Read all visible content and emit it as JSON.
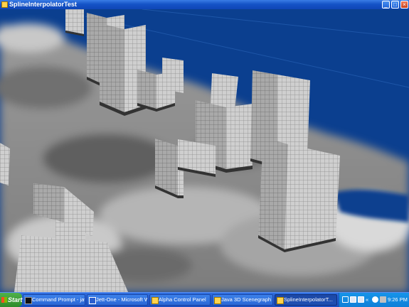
{
  "window": {
    "title": "SplineInterpolatorTest",
    "controls": {
      "minimize": "_",
      "maximize": "□",
      "close": "×"
    }
  },
  "scene": {
    "sky_color": "#0b3f8f",
    "ground_color": "#8d8d8d",
    "building_color": "#d0d0d0",
    "building_top_color": "#333333"
  },
  "taskbar": {
    "start_label": "Start",
    "tasks": [
      {
        "label": "Command Prompt - jav...",
        "icon": "command-prompt-icon",
        "active": false
      },
      {
        "label": "Jett-One - Microsoft Word",
        "icon": "word-icon",
        "active": false
      },
      {
        "label": "Alpha Control Panel",
        "icon": "java-icon",
        "active": false
      },
      {
        "label": "Java 3D Scenegraph",
        "icon": "java-icon",
        "active": false
      },
      {
        "label": "SplineInterpolatorT...",
        "icon": "java-icon",
        "active": true
      }
    ],
    "tray": {
      "expand": "«",
      "clock": "9:26 PM"
    }
  }
}
